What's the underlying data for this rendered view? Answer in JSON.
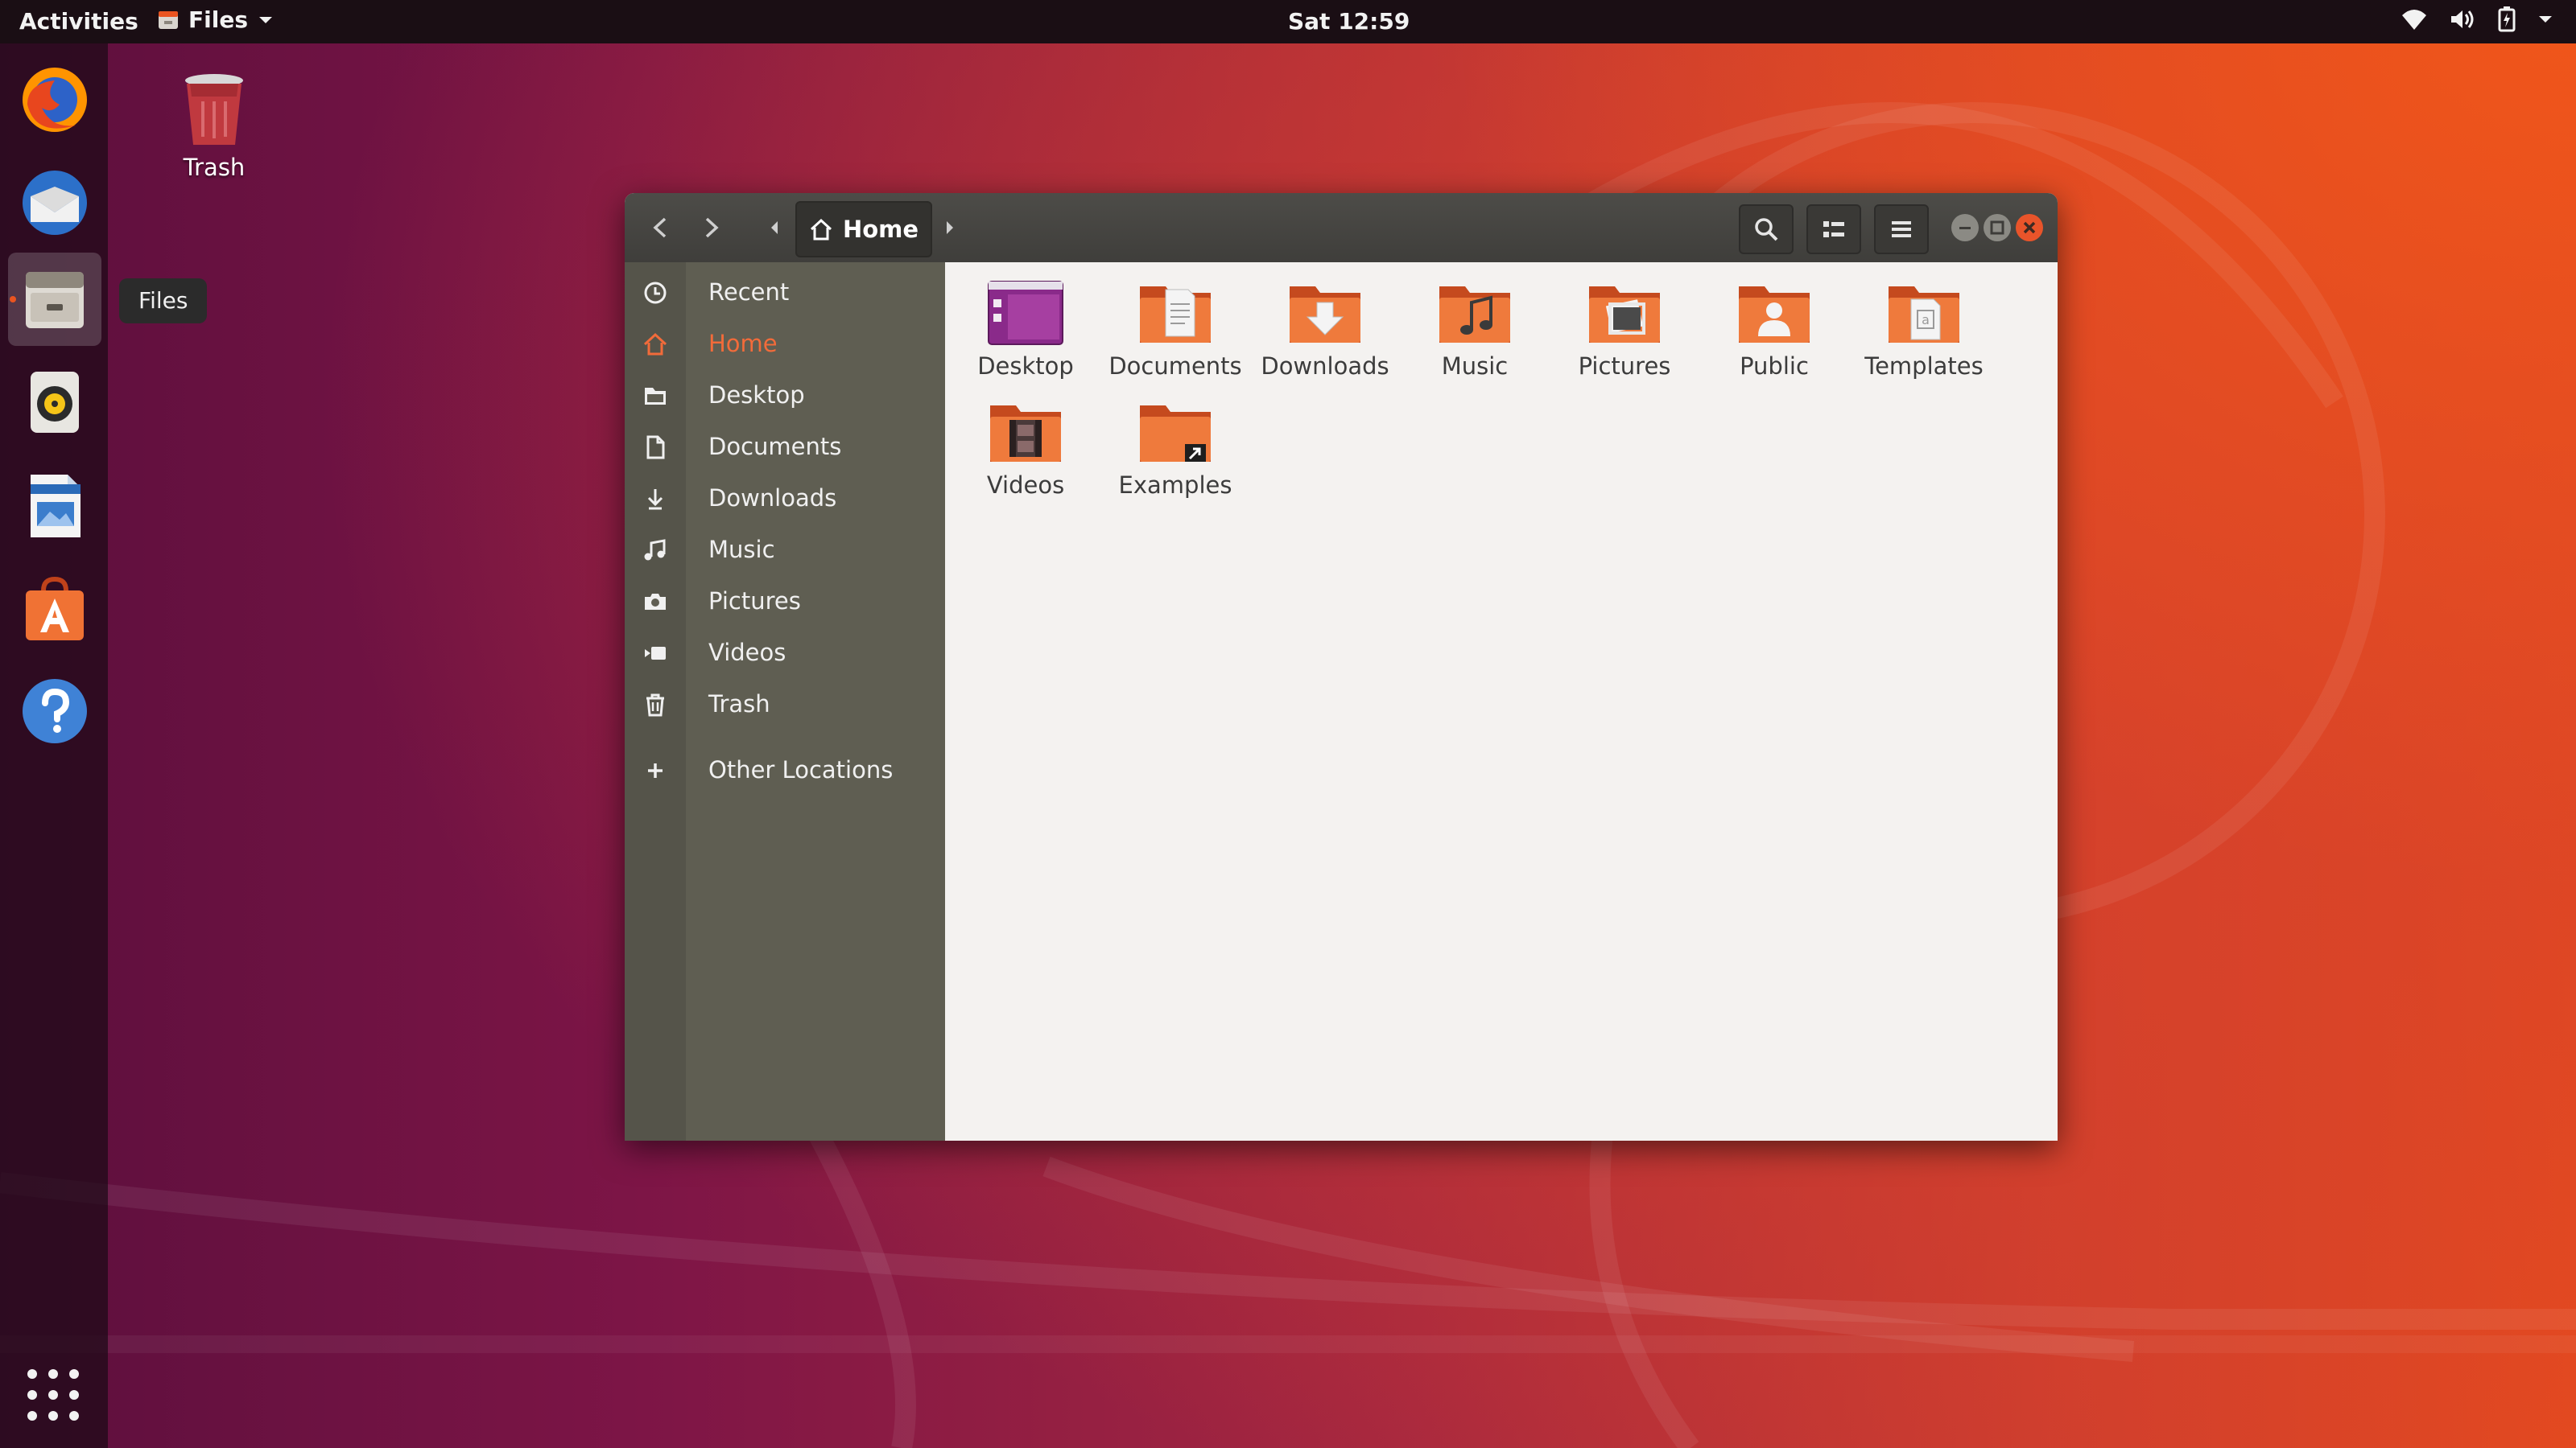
{
  "topbar": {
    "activities": "Activities",
    "app_name": "Files",
    "clock": "Sat 12:59"
  },
  "dock": {
    "tooltip": "Files",
    "apps": [
      {
        "name": "Firefox Web Browser",
        "icon": "firefox-icon"
      },
      {
        "name": "Thunderbird Mail",
        "icon": "thunderbird-icon"
      },
      {
        "name": "Files",
        "icon": "files-icon",
        "active": true
      },
      {
        "name": "Rhythmbox",
        "icon": "rhythmbox-icon"
      },
      {
        "name": "LibreOffice Writer",
        "icon": "writer-icon"
      },
      {
        "name": "Ubuntu Software",
        "icon": "software-icon"
      },
      {
        "name": "Help",
        "icon": "help-icon"
      }
    ],
    "show_apps_icon": "app-grid-icon"
  },
  "desktop": {
    "trash_label": "Trash"
  },
  "window": {
    "path_home": "Home",
    "sidebar": {
      "items": [
        {
          "label": "Recent",
          "icon": "clock-icon"
        },
        {
          "label": "Home",
          "icon": "home-icon",
          "active": true
        },
        {
          "label": "Desktop",
          "icon": "folder-icon"
        },
        {
          "label": "Documents",
          "icon": "document-icon"
        },
        {
          "label": "Downloads",
          "icon": "download-icon"
        },
        {
          "label": "Music",
          "icon": "music-icon"
        },
        {
          "label": "Pictures",
          "icon": "camera-icon"
        },
        {
          "label": "Videos",
          "icon": "video-icon"
        },
        {
          "label": "Trash",
          "icon": "trash-icon"
        }
      ],
      "other_locations": "Other Locations"
    },
    "files": [
      {
        "label": "Desktop",
        "type": "desktop-folder"
      },
      {
        "label": "Documents",
        "type": "documents-folder"
      },
      {
        "label": "Downloads",
        "type": "downloads-folder"
      },
      {
        "label": "Music",
        "type": "music-folder"
      },
      {
        "label": "Pictures",
        "type": "pictures-folder"
      },
      {
        "label": "Public",
        "type": "public-folder"
      },
      {
        "label": "Templates",
        "type": "templates-folder"
      },
      {
        "label": "Videos",
        "type": "videos-folder"
      },
      {
        "label": "Examples",
        "type": "examples-link-folder"
      }
    ]
  },
  "colors": {
    "accent": "#e95420",
    "sidebar": "#5f5e52",
    "headerbar": "#45443f"
  }
}
